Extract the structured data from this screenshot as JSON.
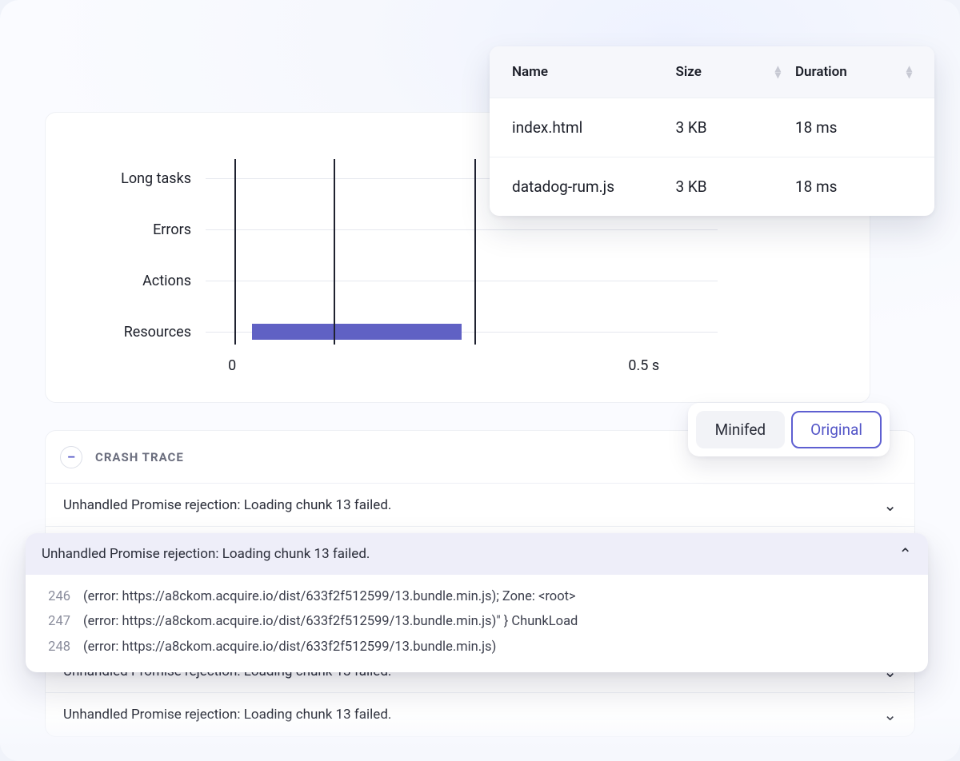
{
  "chart_data": {
    "type": "bar",
    "orientation": "horizontal",
    "categories": [
      "Long tasks",
      "Errors",
      "Actions",
      "Resources"
    ],
    "series": [
      {
        "name": "Resources",
        "start": 0.07,
        "end": 0.4
      }
    ],
    "x_ticks": [
      "0",
      "0.5 s"
    ],
    "xlim": [
      0,
      0.8
    ],
    "vlines_x": [
      0.03,
      0.16,
      0.38
    ]
  },
  "resources": {
    "columns": {
      "name": "Name",
      "size": "Size",
      "duration": "Duration"
    },
    "rows": [
      {
        "name": "index.html",
        "size": "3 KB",
        "duration": "18 ms"
      },
      {
        "name": "datadog-rum.js",
        "size": "3 KB",
        "duration": "18 ms"
      }
    ]
  },
  "toggle": {
    "minified": "Minifed",
    "original": "Original"
  },
  "trace": {
    "title": "CRASH TRACE",
    "rows": [
      "Unhandled Promise rejection: Loading chunk 13 failed.",
      "Unhandled Promise rejection: Loading chunk 13 failed.",
      "Unhandled Promise rejection: Loading chunk 13 failed.",
      "Unhandled Promise rejection: Loading chunk 13 failed."
    ],
    "expanded_index": 1,
    "code": [
      {
        "ln": "246",
        "text": "(error: https://a8ckom.acquire.io/dist/633f2f512599/13.bundle.min.js); Zone: <root>"
      },
      {
        "ln": "247",
        "text": "(error: https://a8ckom.acquire.io/dist/633f2f512599/13.bundle.min.js)\" } ChunkLoad"
      },
      {
        "ln": "248",
        "text": "(error: https://a8ckom.acquire.io/dist/633f2f512599/13.bundle.min.js)"
      }
    ]
  }
}
